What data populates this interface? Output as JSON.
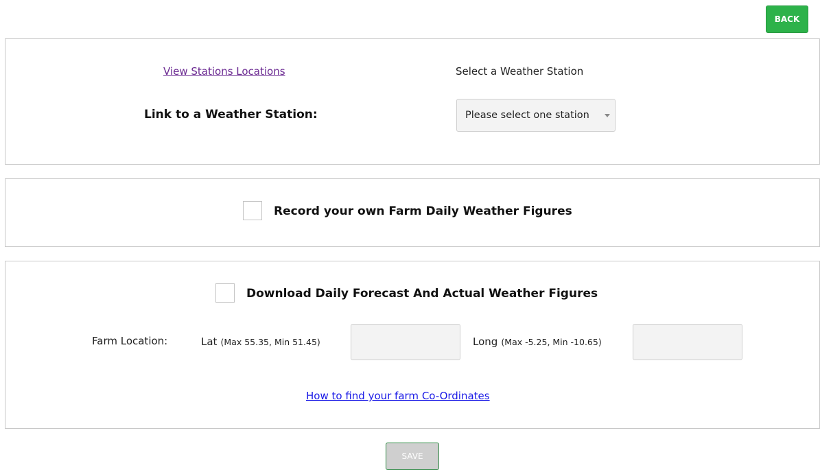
{
  "header": {
    "back_label": "BACK"
  },
  "station_panel": {
    "view_stations_link": "View Stations Locations",
    "select_label": "Select a Weather Station",
    "link_label": "Link to a Weather Station:",
    "station_select": {
      "selected_value": "Please select one station"
    }
  },
  "record_panel": {
    "checkbox_label": "Record your own Farm Daily Weather Figures",
    "checked": false
  },
  "download_panel": {
    "checkbox_label": "Download Daily Forecast And Actual Weather Figures",
    "checked": false,
    "farm_location_label": "Farm Location:",
    "lat_label": "Lat",
    "lat_range": "(Max 55.35, Min 51.45)",
    "lat_value": "",
    "long_label": "Long",
    "long_range": "(Max -5.25, Min -10.65)",
    "long_value": "",
    "coordinates_link": "How to find your farm Co-Ordinates"
  },
  "footer": {
    "save_label": "SAVE"
  },
  "colors": {
    "primary_green": "#2db24a",
    "disabled_gray": "#cfcfcf",
    "visited_link": "#6b2a92",
    "link_blue": "#1a1ae6"
  }
}
